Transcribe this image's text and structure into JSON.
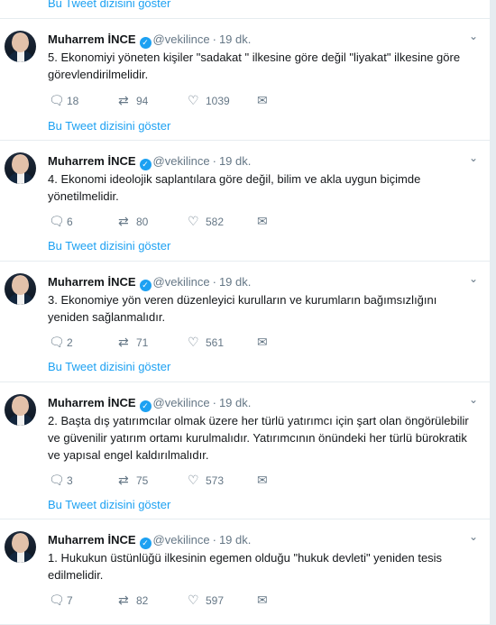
{
  "top_thread_link": "Bu Tweet dizisini göster",
  "tweets": [
    {
      "name": "Muharrem İNCE",
      "handle": "@vekilince",
      "time": "19 dk.",
      "text": "5. Ekonomiyi yöneten kişiler \"sadakat \" ilkesine göre değil \"liyakat\" ilkesine göre görevlendirilmelidir.",
      "replies": "18",
      "retweets": "94",
      "likes": "1039",
      "thread_link": "Bu Tweet dizisini göster"
    },
    {
      "name": "Muharrem İNCE",
      "handle": "@vekilince",
      "time": "19 dk.",
      "text": "4. Ekonomi ideolojik saplantılara göre değil, bilim ve akla uygun biçimde yönetilmelidir.",
      "replies": "6",
      "retweets": "80",
      "likes": "582",
      "thread_link": "Bu Tweet dizisini göster"
    },
    {
      "name": "Muharrem İNCE",
      "handle": "@vekilince",
      "time": "19 dk.",
      "text": "3. Ekonomiye yön veren düzenleyici kurulların ve kurumların bağımsızlığını yeniden sağlanmalıdır.",
      "replies": "2",
      "retweets": "71",
      "likes": "561",
      "thread_link": "Bu Tweet dizisini göster"
    },
    {
      "name": "Muharrem İNCE",
      "handle": "@vekilince",
      "time": "19 dk.",
      "text": "2. Başta dış yatırımcılar olmak üzere her türlü yatırımcı için şart olan öngörülebilir ve güvenilir yatırım ortamı kurulmalıdır. Yatırımcının önündeki her türlü bürokratik ve yapısal engel kaldırılmalıdır.",
      "replies": "3",
      "retweets": "75",
      "likes": "573",
      "thread_link": "Bu Tweet dizisini göster"
    },
    {
      "name": "Muharrem İNCE",
      "handle": "@vekilince",
      "time": "19 dk.",
      "text": "1. Hukukun üstünlüğü ilkesinin egemen olduğu \"hukuk devleti\" yeniden tesis edilmelidir.",
      "replies": "7",
      "retweets": "82",
      "likes": "597"
    }
  ]
}
